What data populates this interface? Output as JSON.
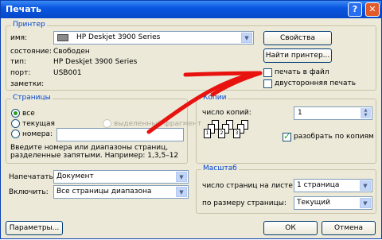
{
  "window": {
    "title": "Печать",
    "help_icon": "?",
    "close_icon": "✕"
  },
  "printer": {
    "legend": "Принтер",
    "name_label": "имя:",
    "name_value": "HP Deskjet 3900 Series",
    "state_label": "состояние:",
    "state_value": "Свободен",
    "type_label": "тип:",
    "type_value": "HP Deskjet 3900 Series",
    "port_label": "порт:",
    "port_value": "USB001",
    "notes_label": "заметки:",
    "properties_button": "Свойства",
    "find_button": "Найти принтер...",
    "print_to_file": "печать в файл",
    "duplex": "двусторонняя печать"
  },
  "pages": {
    "legend": "Страницы",
    "all": "все",
    "current": "текущая",
    "selection": "выделенный фрагмент",
    "numbers": "номера:",
    "hint": "Введите номера или диапазоны страниц, разделенные запятыми. Например: 1,3,5–12"
  },
  "copies": {
    "legend": "Копии",
    "count_label": "число копий:",
    "count_value": "1",
    "collate": "разобрать по копиям",
    "page_numbers": [
      "1",
      "2",
      "3"
    ]
  },
  "print_what": {
    "label": "Напечатать:",
    "value": "Документ"
  },
  "include": {
    "label": "Включить:",
    "value": "Все страницы диапазона"
  },
  "zoom": {
    "legend": "Масштаб",
    "pages_per_sheet_label": "число страниц на листе:",
    "pages_per_sheet_value": "1 страница",
    "scale_label": "по размеру страницы:",
    "scale_value": "Текущий"
  },
  "footer": {
    "options": "Параметры...",
    "ok": "ОК",
    "cancel": "Отмена"
  },
  "annotation": {
    "color": "#e8120f"
  }
}
